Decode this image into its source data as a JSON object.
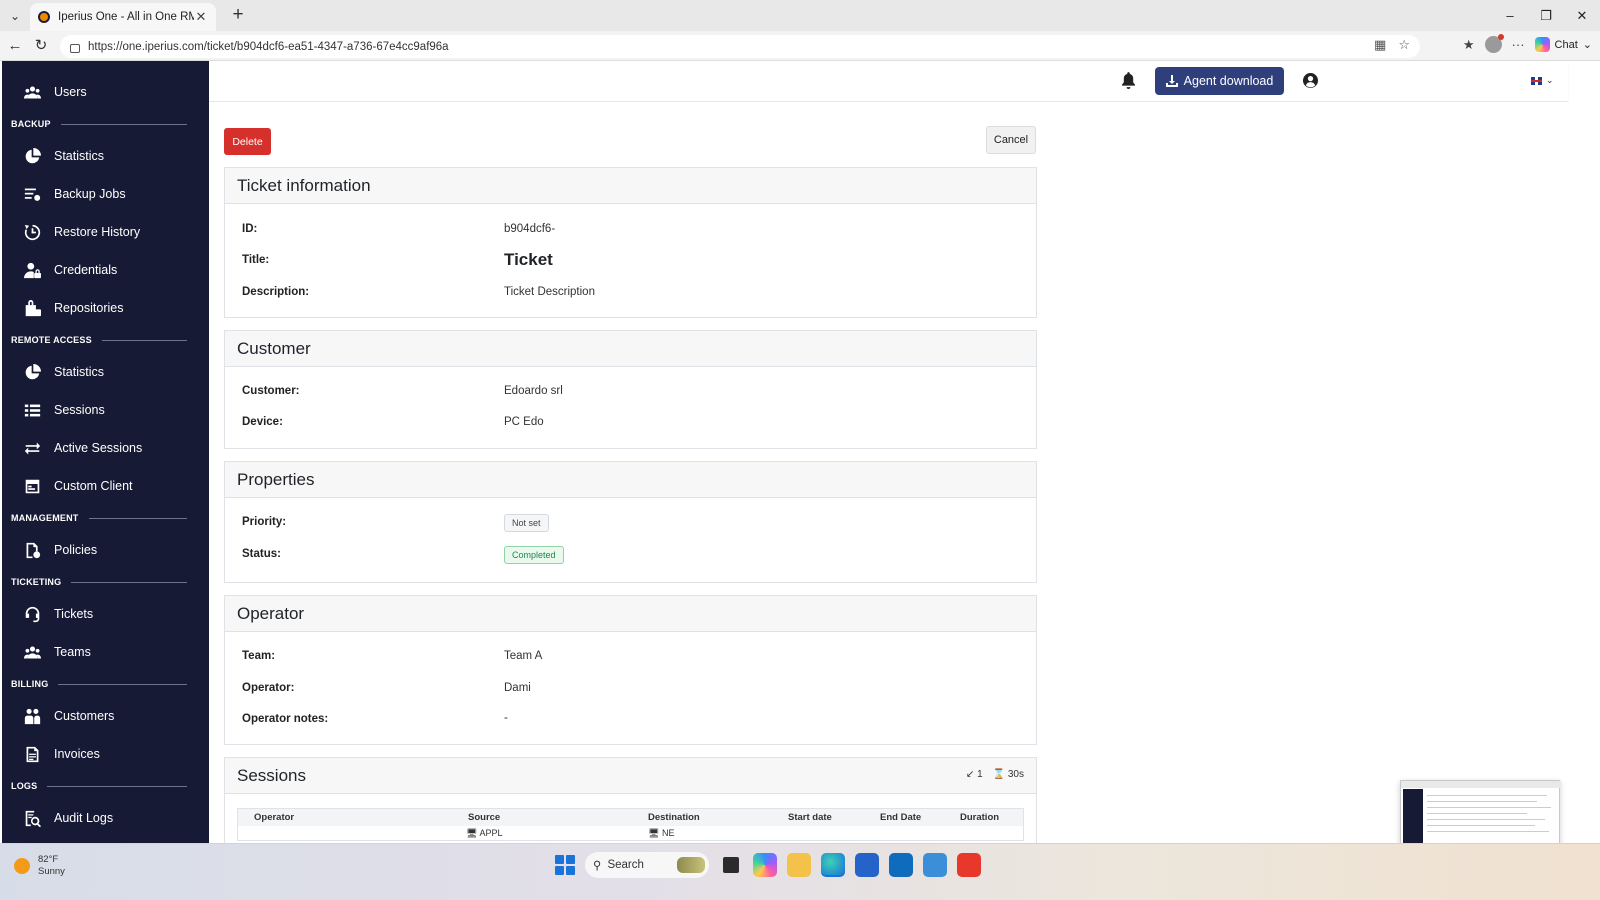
{
  "browser": {
    "tab_title": "Iperius One - All in One RMM Suite",
    "url": "https://one.iperius.com/ticket/b904dcf6-ea51-4347-a736-67e4cc9af96a",
    "chat_label": "Chat"
  },
  "sidebar": {
    "users": "Users",
    "backup_header": "BACKUP",
    "backup_items": [
      "Statistics",
      "Backup Jobs",
      "Restore History",
      "Credentials",
      "Repositories"
    ],
    "remote_header": "REMOTE ACCESS",
    "remote_items": [
      "Statistics",
      "Sessions",
      "Active Sessions",
      "Custom Client"
    ],
    "management_header": "MANAGEMENT",
    "management_items": [
      "Policies"
    ],
    "ticketing_header": "TICKETING",
    "ticketing_items": [
      "Tickets",
      "Teams"
    ],
    "billing_header": "BILLING",
    "billing_items": [
      "Customers",
      "Invoices"
    ],
    "logs_header": "LOGS",
    "logs_items": [
      "Audit Logs"
    ]
  },
  "topbar": {
    "agent_download": "Agent download"
  },
  "actions": {
    "delete": "Delete",
    "cancel": "Cancel"
  },
  "ticket_info": {
    "header": "Ticket information",
    "id_label": "ID:",
    "id_value": "b904dcf6-",
    "title_label": "Title:",
    "title_value": "Ticket",
    "description_label": "Description:",
    "description_value": "Ticket Description"
  },
  "customer": {
    "header": "Customer",
    "customer_label": "Customer:",
    "customer_value": "Edoardo srl",
    "device_label": "Device:",
    "device_value": "PC Edo"
  },
  "properties": {
    "header": "Properties",
    "priority_label": "Priority:",
    "priority_value": "Not set",
    "status_label": "Status:",
    "status_value": "Completed"
  },
  "operator": {
    "header": "Operator",
    "team_label": "Team:",
    "team_value": "Team A",
    "operator_label": "Operator:",
    "operator_value": "Dami",
    "notes_label": "Operator notes:",
    "notes_value": "-"
  },
  "sessions": {
    "header": "Sessions",
    "count": "1",
    "total_duration": "30s",
    "columns": [
      "Operator",
      "Source",
      "Destination",
      "Start date",
      "End Date",
      "Duration"
    ],
    "row_source": "APPL",
    "row_destination": "NE"
  },
  "taskbar": {
    "temperature": "82°F",
    "condition": "Sunny",
    "search": "Search"
  },
  "colors": {
    "sidebar_bg": "#161a34",
    "primary": "#2e3f7c",
    "danger": "#d6302c",
    "success": "#1d8a44"
  }
}
